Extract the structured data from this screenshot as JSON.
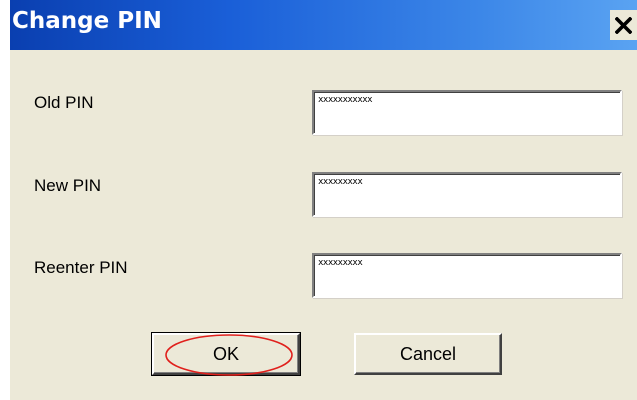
{
  "window": {
    "title": "Change PIN",
    "close_icon": "close-x-icon"
  },
  "fields": [
    {
      "label": "Old PIN",
      "value": "xxxxxxxxxxx"
    },
    {
      "label": "New PIN",
      "value": "xxxxxxxxx"
    },
    {
      "label": "Reenter PIN",
      "value": "xxxxxxxxx"
    }
  ],
  "buttons": {
    "ok_label": "OK",
    "cancel_label": "Cancel"
  },
  "annotation": {
    "highlight_color": "#e0201c",
    "highlighted_element": "ok-button"
  },
  "colors": {
    "titlebar_start": "#0a3fb0",
    "titlebar_end": "#5aa3f2",
    "dialog_bg": "#ece9d8"
  }
}
